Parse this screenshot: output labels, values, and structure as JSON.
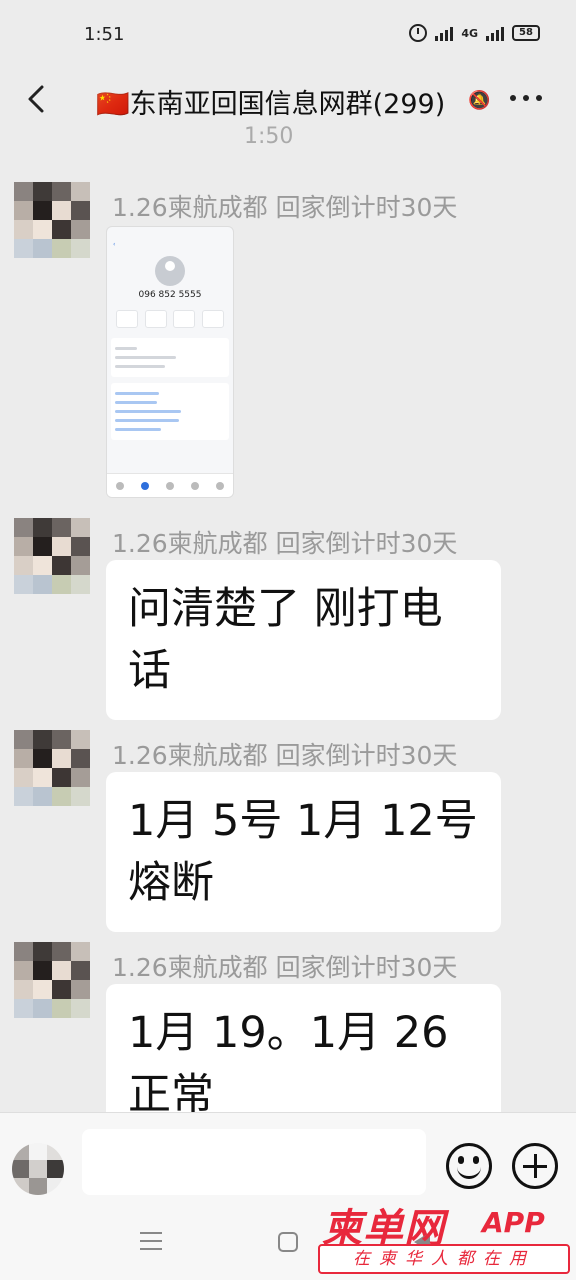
{
  "status_bar": {
    "time": "1:51",
    "network_label": "4G",
    "battery_level": "58"
  },
  "header": {
    "flag": "🇨🇳",
    "title": "东南亚回国信息网群(299)"
  },
  "timestamp_partial": "1:50",
  "messages": [
    {
      "sender": "1.26柬航成都 回家倒计时30天",
      "type": "image",
      "image_content": {
        "phone_number": "096 852 5555"
      }
    },
    {
      "sender": "1.26柬航成都 回家倒计时30天",
      "type": "text",
      "text": "问清楚了 刚打电话"
    },
    {
      "sender": "1.26柬航成都 回家倒计时30天",
      "type": "text",
      "text": "1月 5号 1月 12号熔断"
    },
    {
      "sender": "1.26柬航成都 回家倒计时30天",
      "type": "text",
      "text": "1月 19。1月 26正常"
    }
  ],
  "input_bar": {
    "placeholder": ""
  },
  "watermark": {
    "logo": "柬单网",
    "app": "APP",
    "slogan": "在柬华人都在用"
  },
  "colors": {
    "background": "#ececec",
    "bubble": "#ffffff",
    "sender_text": "#9a9a9a",
    "watermark": "#e8283c"
  }
}
